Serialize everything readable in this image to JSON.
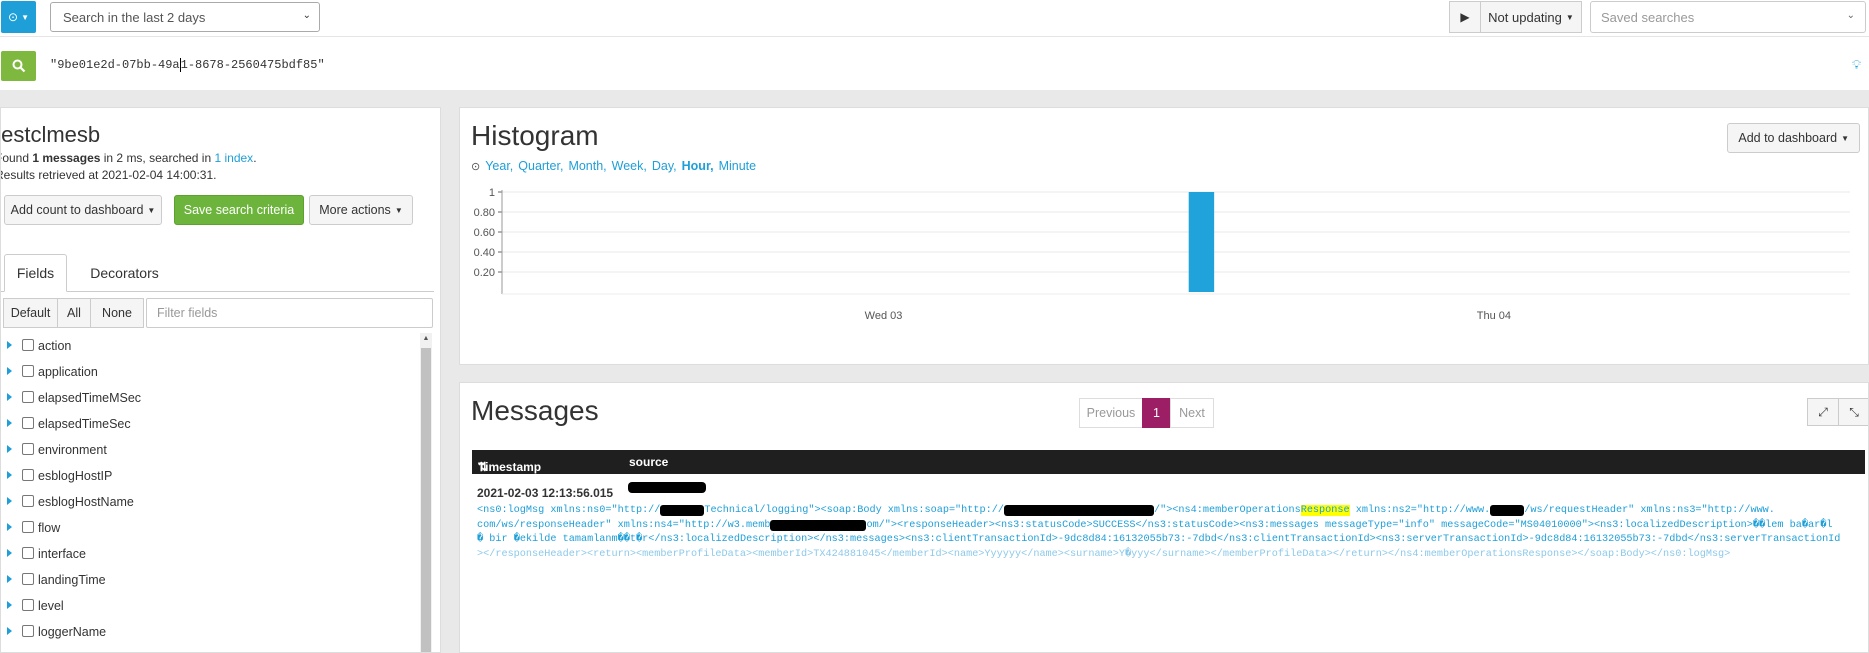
{
  "topbar": {
    "range_value": "Search in the last 2 days",
    "updating_label": "Not updating",
    "saved_searches_placeholder": "Saved searches"
  },
  "query": {
    "text_before_cursor": "\"9be01e2d-07bb-49a",
    "text_after_cursor": "1-8678-2560475bdf85\""
  },
  "sidebar": {
    "stream_title": "testclmesb",
    "found_prefix": "Found ",
    "found_count": "1 messages",
    "found_mid": " in 2 ms, searched in ",
    "found_index": "1 index",
    "found_end": ".",
    "retrieved": "Results retrieved at 2021-02-04 14:00:31.",
    "add_count_label": "Add count to dashboard",
    "save_search_label": "Save search criteria",
    "more_actions_label": "More actions",
    "tabs": [
      "Fields",
      "Decorators"
    ],
    "field_buttons": [
      "Default",
      "All",
      "None"
    ],
    "filter_placeholder": "Filter fields",
    "fields": [
      "action",
      "application",
      "elapsedTimeMSec",
      "elapsedTimeSec",
      "environment",
      "esblogHostIP",
      "esblogHostName",
      "flow",
      "interface",
      "landingTime",
      "level",
      "loggerName"
    ]
  },
  "histogram": {
    "title": "Histogram",
    "add_to_dashboard_label": "Add to dashboard",
    "resolutions": [
      "Year,",
      "Quarter,",
      "Month,",
      "Week,",
      "Day,",
      "Hour,",
      "Minute"
    ],
    "active_resolution": "Hour,"
  },
  "chart_data": {
    "type": "bar",
    "x_tick_labels": [
      "Wed 03",
      "Thu 04"
    ],
    "y_tick_labels": [
      "1",
      "0.80",
      "0.60",
      "0.40",
      "0.20"
    ],
    "ylim": [
      0,
      1
    ],
    "bars": [
      {
        "x": "2021-02-03 12:00",
        "value": 1
      }
    ],
    "grid": true,
    "color": "#1fa3da"
  },
  "messages": {
    "title": "Messages",
    "pager": [
      "Previous",
      "1",
      "Next"
    ],
    "col_timestamp": "Timestamp",
    "col_source": "source",
    "row": {
      "timestamp": "2021-02-03 12:13:56.015",
      "line1_a": "<ns0:logMsg xmlns:ns0=\"http://",
      "line1_b": "Technical/logging\"><soap:Body xmlns:soap=\"http://",
      "line1_c": "/\"><ns4:memberOperations",
      "line1_hl": "Response",
      "line1_d": " xmlns:ns2=\"http://www.",
      "line1_e": "/ws/requestHeader\" xmlns:ns3=\"http://www.",
      "line2_a": "com/ws/responseHeader\" xmlns:ns4=\"http://w3.memb",
      "line2_b": "om/\"><responseHeader><ns3:statusCode>SUCCESS</ns3:statusCode><ns3:messages messageType=\"info\" messageCode=\"MS04010000\"><ns3:localizedDescription>��lem ba�ar�l",
      "line3": "� bir �ekilde tamamlanm��t�r</ns3:localizedDescription></ns3:messages><ns3:clientTransactionId>-9dc8d84:16132055b73:-7dbd</ns3:clientTransactionId><ns3:serverTransactionId>-9dc8d84:16132055b73:-7dbd</ns3:serverTransactionId",
      "line4": "></responseHeader><return><memberProfileData><memberId>TX424881045</memberId><name>Yyyyyy</name><surname>Y�yyy</surname></memberProfileData></return></ns4:memberOperationsResponse></soap:Body></ns0:logMsg>"
    }
  },
  "colors": {
    "accent": "#1e9fd8",
    "search_green": "#7fb83f",
    "save_green": "#6cb43b",
    "pager_active": "#9c1f65",
    "header_dark": "#1f1f1f"
  }
}
